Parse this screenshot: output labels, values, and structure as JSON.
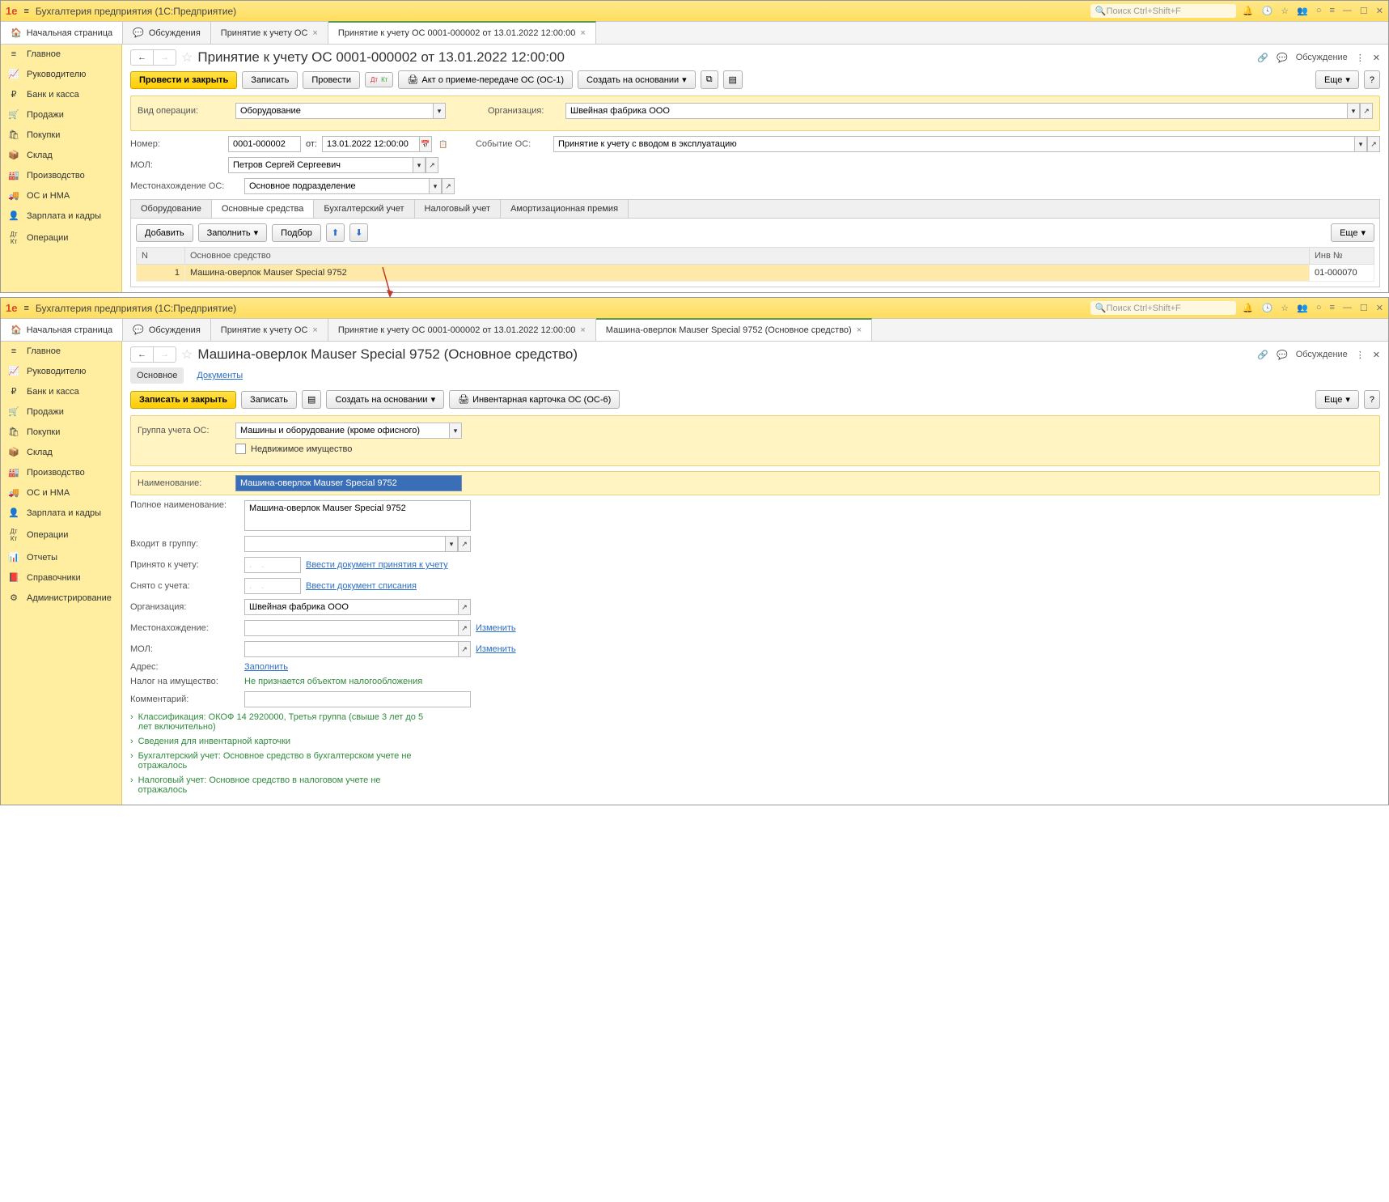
{
  "app_title": "Бухгалтерия предприятия  (1С:Предприятие)",
  "search_placeholder": "Поиск Ctrl+Shift+F",
  "home_tab": "Начальная страница",
  "top": {
    "tabs": [
      {
        "icon": "chat",
        "label": "Обсуждения"
      },
      {
        "label": "Принятие к учету ОС",
        "close": true
      },
      {
        "label": "Принятие к учету ОС 0001-000002 от 13.01.2022 12:00:00",
        "close": true,
        "active": true
      }
    ],
    "sidebar": [
      {
        "icon": "≡",
        "label": "Главное"
      },
      {
        "icon": "↗",
        "label": "Руководителю"
      },
      {
        "icon": "₽",
        "label": "Банк и касса"
      },
      {
        "icon": "🛒",
        "label": "Продажи"
      },
      {
        "icon": "🛍",
        "label": "Покупки"
      },
      {
        "icon": "🏬",
        "label": "Склад"
      },
      {
        "icon": "🏭",
        "label": "Производство"
      },
      {
        "icon": "🚚",
        "label": "ОС и НМА"
      },
      {
        "icon": "👤",
        "label": "Зарплата и кадры"
      },
      {
        "icon": "Дт",
        "label": "Операции"
      }
    ],
    "page_title": "Принятие к учету ОС 0001-000002 от 13.01.2022 12:00:00",
    "discuss": "Обсуждение",
    "toolbar": {
      "primary": "Провести и закрыть",
      "save": "Записать",
      "post": "Провести",
      "act": "Акт о приеме-передаче ОС (ОС-1)",
      "create_based": "Создать на основании",
      "more": "Еще"
    },
    "form": {
      "op_type_label": "Вид операции:",
      "op_type": "Оборудование",
      "org_label": "Организация:",
      "org": "Швейная фабрика ООО",
      "num_label": "Номер:",
      "num": "0001-000002",
      "from_label": "от:",
      "date": "13.01.2022 12:00:00",
      "event_label": "Событие ОС:",
      "event": "Принятие к учету с вводом в эксплуатацию",
      "mol_label": "МОЛ:",
      "mol": "Петров Сергей Сергеевич",
      "loc_label": "Местонахождение ОС:",
      "loc": "Основное подразделение"
    },
    "subtabs": [
      "Оборудование",
      "Основные средства",
      "Бухгалтерский учет",
      "Налоговый учет",
      "Амортизационная премия"
    ],
    "subtab_active": 1,
    "tb2": {
      "add": "Добавить",
      "fill": "Заполнить",
      "pick": "Подбор",
      "more": "Еще"
    },
    "table": {
      "cols": [
        "N",
        "Основное средство",
        "Инв №"
      ],
      "row": {
        "n": "1",
        "name": "Машина-оверлок Mauser Special 9752",
        "inv": "01-000070"
      }
    }
  },
  "bottom": {
    "tabs": [
      {
        "icon": "chat",
        "label": "Обсуждения"
      },
      {
        "label": "Принятие к учету ОС",
        "close": true
      },
      {
        "label": "Принятие к учету ОС 0001-000002 от 13.01.2022 12:00:00",
        "close": true
      },
      {
        "label": "Машина-оверлок Mauser Special 9752 (Основное средство)",
        "close": true,
        "active": true
      }
    ],
    "sidebar": [
      {
        "icon": "≡",
        "label": "Главное"
      },
      {
        "icon": "↗",
        "label": "Руководителю"
      },
      {
        "icon": "₽",
        "label": "Банк и касса"
      },
      {
        "icon": "🛒",
        "label": "Продажи"
      },
      {
        "icon": "🛍",
        "label": "Покупки"
      },
      {
        "icon": "🏬",
        "label": "Склад"
      },
      {
        "icon": "🏭",
        "label": "Производство"
      },
      {
        "icon": "🚚",
        "label": "ОС и НМА"
      },
      {
        "icon": "👤",
        "label": "Зарплата и кадры"
      },
      {
        "icon": "Дт",
        "label": "Операции"
      },
      {
        "icon": "📊",
        "label": "Отчеты"
      },
      {
        "icon": "📕",
        "label": "Справочники"
      },
      {
        "icon": "⚙",
        "label": "Администрирование"
      }
    ],
    "page_title": "Машина-оверлок Mauser Special 9752 (Основное средство)",
    "discuss": "Обсуждение",
    "section_tabs": {
      "main": "Основное",
      "docs": "Документы"
    },
    "toolbar": {
      "primary": "Записать и закрыть",
      "save": "Записать",
      "create_based": "Создать на основании",
      "card": "Инвентарная карточка ОС (ОС-6)",
      "more": "Еще"
    },
    "form": {
      "group_label": "Группа учета ОС:",
      "group": "Машины и оборудование (кроме офисного)",
      "immov": "Недвижимое имущество",
      "name_label": "Наименование:",
      "name": "Машина-оверлок Mauser Special 9752",
      "fullname_label": "Полное наименование:",
      "fullname": "Машина-оверлок Mauser Special 9752",
      "in_group_label": "Входит в группу:",
      "accepted_label": "Принято к учету:",
      "accepted_ph": ".  .",
      "accepted_link": "Ввести документ принятия к учету",
      "removed_label": "Снято с учета:",
      "removed_ph": ".  .",
      "removed_link": "Ввести документ списания",
      "org_label": "Организация:",
      "org": "Швейная фабрика ООО",
      "loc_label": "Местонахождение:",
      "change1": "Изменить",
      "mol_label": "МОЛ:",
      "change2": "Изменить",
      "addr_label": "Адрес:",
      "fill_link": "Заполнить",
      "tax_label": "Налог на имущество:",
      "tax_val": "Не признается объектом налогообложения",
      "comment_label": "Комментарий:"
    },
    "expand": [
      "Классификация: ОКОФ 14 2920000, Третья группа (свыше 3 лет до 5 лет включительно)",
      "Сведения для инвентарной карточки",
      "Бухгалтерский учет: Основное средство в бухгалтерском учете не отражалось",
      "Налоговый учет: Основное средство в налоговом учете не отражалось"
    ]
  }
}
